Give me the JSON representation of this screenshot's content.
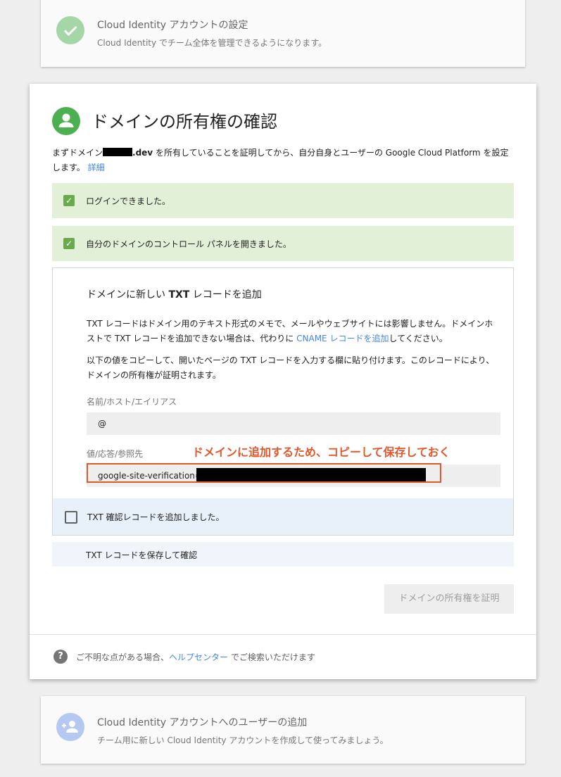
{
  "top_step": {
    "title": "Cloud Identity アカウントの設定",
    "subtitle": "Cloud Identity でチーム全体を管理できるようになります。",
    "icon": "check-circle-icon",
    "icon_color": "#a5d6a7"
  },
  "main": {
    "title": "ドメインの所有権の確認",
    "icon": "person-icon",
    "intro_before": "まずドメイン",
    "intro_domain_suffix": ".dev",
    "intro_after": " を所有していることを証明してから、自分自身とユーザーの Google Cloud Platform を設定します。",
    "intro_link": "詳細",
    "success_1": "ログインできました。",
    "success_2": "自分のドメインのコントロール パネルを開きました。",
    "txt": {
      "title_before": "ドメインに新しい ",
      "title_bold": "TXT",
      "title_after": " レコードを追加",
      "para1_before": "TXT レコードはドメイン用のテキスト形式のメモで、メールやウェブサイトには影響しません。ドメインホストで TXT レコードを追加できない場合は、代わりに ",
      "para1_link": "CNAME レコードを追加",
      "para1_after": "してください。",
      "para2": "以下の値をコピーして、開いたページの TXT レコードを入力する欄に貼り付けます。このレコードにより、ドメインの所有権が証明されます。",
      "name_label": "名前/ホスト/エイリアス",
      "name_value": "@",
      "value_label": "値/応答/参照先",
      "value_prefix": "google-site-verification=",
      "annotation": "ドメインに追加するため、コピーして保存しておく",
      "confirm_label": "TXT 確認レコードを追加しました。"
    },
    "save_label": "TXT レコードを保存して確認",
    "verify_button": "ドメインの所有権を証明",
    "help_before": "ご不明な点がある場合、",
    "help_link": "ヘルプセンター",
    "help_after": " でご検索いただけます"
  },
  "bottom_step": {
    "title": "Cloud Identity アカウントへのユーザーの追加",
    "subtitle": "チーム用に新しい Cloud Identity アカウントを作成して使ってみましょう。",
    "icon": "add-user-icon",
    "icon_color": "#b5c8f2"
  },
  "colors": {
    "success_bg": "#e3f0d8",
    "check_green": "#6aaa4d",
    "link_blue": "#4285f4",
    "annotation_red": "#e1582b",
    "confirm_bg": "#e8f0fa"
  }
}
